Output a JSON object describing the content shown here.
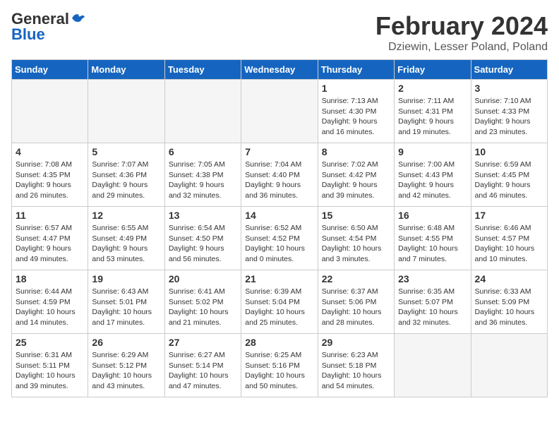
{
  "header": {
    "logo_general": "General",
    "logo_blue": "Blue",
    "month_title": "February 2024",
    "location": "Dziewin, Lesser Poland, Poland"
  },
  "days_of_week": [
    "Sunday",
    "Monday",
    "Tuesday",
    "Wednesday",
    "Thursday",
    "Friday",
    "Saturday"
  ],
  "weeks": [
    [
      {
        "num": "",
        "info": "",
        "empty": true
      },
      {
        "num": "",
        "info": "",
        "empty": true
      },
      {
        "num": "",
        "info": "",
        "empty": true
      },
      {
        "num": "",
        "info": "",
        "empty": true
      },
      {
        "num": "1",
        "info": "Sunrise: 7:13 AM\nSunset: 4:30 PM\nDaylight: 9 hours\nand 16 minutes.",
        "empty": false
      },
      {
        "num": "2",
        "info": "Sunrise: 7:11 AM\nSunset: 4:31 PM\nDaylight: 9 hours\nand 19 minutes.",
        "empty": false
      },
      {
        "num": "3",
        "info": "Sunrise: 7:10 AM\nSunset: 4:33 PM\nDaylight: 9 hours\nand 23 minutes.",
        "empty": false
      }
    ],
    [
      {
        "num": "4",
        "info": "Sunrise: 7:08 AM\nSunset: 4:35 PM\nDaylight: 9 hours\nand 26 minutes.",
        "empty": false
      },
      {
        "num": "5",
        "info": "Sunrise: 7:07 AM\nSunset: 4:36 PM\nDaylight: 9 hours\nand 29 minutes.",
        "empty": false
      },
      {
        "num": "6",
        "info": "Sunrise: 7:05 AM\nSunset: 4:38 PM\nDaylight: 9 hours\nand 32 minutes.",
        "empty": false
      },
      {
        "num": "7",
        "info": "Sunrise: 7:04 AM\nSunset: 4:40 PM\nDaylight: 9 hours\nand 36 minutes.",
        "empty": false
      },
      {
        "num": "8",
        "info": "Sunrise: 7:02 AM\nSunset: 4:42 PM\nDaylight: 9 hours\nand 39 minutes.",
        "empty": false
      },
      {
        "num": "9",
        "info": "Sunrise: 7:00 AM\nSunset: 4:43 PM\nDaylight: 9 hours\nand 42 minutes.",
        "empty": false
      },
      {
        "num": "10",
        "info": "Sunrise: 6:59 AM\nSunset: 4:45 PM\nDaylight: 9 hours\nand 46 minutes.",
        "empty": false
      }
    ],
    [
      {
        "num": "11",
        "info": "Sunrise: 6:57 AM\nSunset: 4:47 PM\nDaylight: 9 hours\nand 49 minutes.",
        "empty": false
      },
      {
        "num": "12",
        "info": "Sunrise: 6:55 AM\nSunset: 4:49 PM\nDaylight: 9 hours\nand 53 minutes.",
        "empty": false
      },
      {
        "num": "13",
        "info": "Sunrise: 6:54 AM\nSunset: 4:50 PM\nDaylight: 9 hours\nand 56 minutes.",
        "empty": false
      },
      {
        "num": "14",
        "info": "Sunrise: 6:52 AM\nSunset: 4:52 PM\nDaylight: 10 hours\nand 0 minutes.",
        "empty": false
      },
      {
        "num": "15",
        "info": "Sunrise: 6:50 AM\nSunset: 4:54 PM\nDaylight: 10 hours\nand 3 minutes.",
        "empty": false
      },
      {
        "num": "16",
        "info": "Sunrise: 6:48 AM\nSunset: 4:55 PM\nDaylight: 10 hours\nand 7 minutes.",
        "empty": false
      },
      {
        "num": "17",
        "info": "Sunrise: 6:46 AM\nSunset: 4:57 PM\nDaylight: 10 hours\nand 10 minutes.",
        "empty": false
      }
    ],
    [
      {
        "num": "18",
        "info": "Sunrise: 6:44 AM\nSunset: 4:59 PM\nDaylight: 10 hours\nand 14 minutes.",
        "empty": false
      },
      {
        "num": "19",
        "info": "Sunrise: 6:43 AM\nSunset: 5:01 PM\nDaylight: 10 hours\nand 17 minutes.",
        "empty": false
      },
      {
        "num": "20",
        "info": "Sunrise: 6:41 AM\nSunset: 5:02 PM\nDaylight: 10 hours\nand 21 minutes.",
        "empty": false
      },
      {
        "num": "21",
        "info": "Sunrise: 6:39 AM\nSunset: 5:04 PM\nDaylight: 10 hours\nand 25 minutes.",
        "empty": false
      },
      {
        "num": "22",
        "info": "Sunrise: 6:37 AM\nSunset: 5:06 PM\nDaylight: 10 hours\nand 28 minutes.",
        "empty": false
      },
      {
        "num": "23",
        "info": "Sunrise: 6:35 AM\nSunset: 5:07 PM\nDaylight: 10 hours\nand 32 minutes.",
        "empty": false
      },
      {
        "num": "24",
        "info": "Sunrise: 6:33 AM\nSunset: 5:09 PM\nDaylight: 10 hours\nand 36 minutes.",
        "empty": false
      }
    ],
    [
      {
        "num": "25",
        "info": "Sunrise: 6:31 AM\nSunset: 5:11 PM\nDaylight: 10 hours\nand 39 minutes.",
        "empty": false
      },
      {
        "num": "26",
        "info": "Sunrise: 6:29 AM\nSunset: 5:12 PM\nDaylight: 10 hours\nand 43 minutes.",
        "empty": false
      },
      {
        "num": "27",
        "info": "Sunrise: 6:27 AM\nSunset: 5:14 PM\nDaylight: 10 hours\nand 47 minutes.",
        "empty": false
      },
      {
        "num": "28",
        "info": "Sunrise: 6:25 AM\nSunset: 5:16 PM\nDaylight: 10 hours\nand 50 minutes.",
        "empty": false
      },
      {
        "num": "29",
        "info": "Sunrise: 6:23 AM\nSunset: 5:18 PM\nDaylight: 10 hours\nand 54 minutes.",
        "empty": false
      },
      {
        "num": "",
        "info": "",
        "empty": true
      },
      {
        "num": "",
        "info": "",
        "empty": true
      }
    ]
  ]
}
